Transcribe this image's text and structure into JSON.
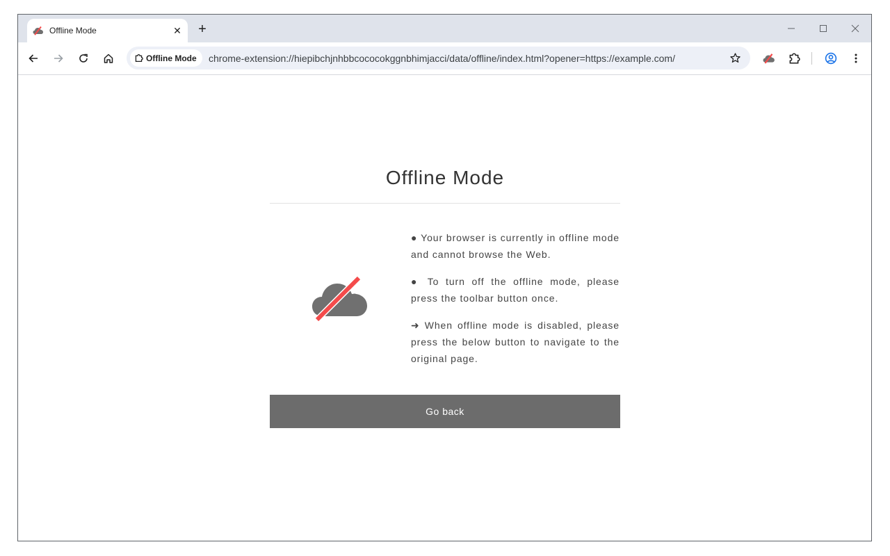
{
  "tab": {
    "title": "Offline Mode",
    "close_glyph": "✕"
  },
  "new_tab_glyph": "+",
  "omnibox": {
    "chip_label": "Offline Mode",
    "url": "chrome-extension://hiepibchjnhbbcococokggnbhimjacci/data/offline/index.html?opener=https://example.com/"
  },
  "page": {
    "heading": "Offline Mode",
    "lines": [
      "● Your browser is currently in offline mode and cannot browse the Web.",
      "● To turn off the offline mode, please press the toolbar button once.",
      "➜ When offline mode is disabled, please press the below button to navigate to the original page."
    ],
    "button_label": "Go back"
  },
  "icons": {
    "favicon": "offline-cloud-icon",
    "back": "arrow-left-icon",
    "forward": "arrow-right-icon",
    "reload": "reload-icon",
    "home": "home-icon",
    "chip": "extension-puzzle-icon",
    "bookmark": "star-icon",
    "extension_action": "offline-cloud-icon",
    "extensions": "puzzle-icon",
    "profile": "profile-icon",
    "menu": "kebab-menu-icon"
  },
  "colors": {
    "tabstrip": "#dfe3eb",
    "omnibox": "#edf0f7",
    "button": "#6c6c6c",
    "cloud": "#707070",
    "slash": "#f44b4b",
    "profile": "#1a73e8"
  }
}
